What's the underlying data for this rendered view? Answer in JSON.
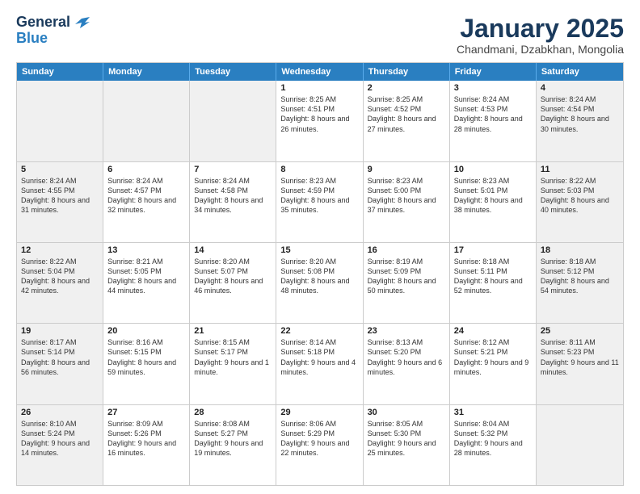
{
  "logo": {
    "general": "General",
    "blue": "Blue"
  },
  "header": {
    "title": "January 2025",
    "subtitle": "Chandmani, Dzabkhan, Mongolia"
  },
  "weekdays": [
    "Sunday",
    "Monday",
    "Tuesday",
    "Wednesday",
    "Thursday",
    "Friday",
    "Saturday"
  ],
  "weeks": [
    [
      {
        "day": "",
        "info": "",
        "shaded": true
      },
      {
        "day": "",
        "info": "",
        "shaded": true
      },
      {
        "day": "",
        "info": "",
        "shaded": true
      },
      {
        "day": "1",
        "info": "Sunrise: 8:25 AM\nSunset: 4:51 PM\nDaylight: 8 hours and 26 minutes.",
        "shaded": false
      },
      {
        "day": "2",
        "info": "Sunrise: 8:25 AM\nSunset: 4:52 PM\nDaylight: 8 hours and 27 minutes.",
        "shaded": false
      },
      {
        "day": "3",
        "info": "Sunrise: 8:24 AM\nSunset: 4:53 PM\nDaylight: 8 hours and 28 minutes.",
        "shaded": false
      },
      {
        "day": "4",
        "info": "Sunrise: 8:24 AM\nSunset: 4:54 PM\nDaylight: 8 hours and 30 minutes.",
        "shaded": true
      }
    ],
    [
      {
        "day": "5",
        "info": "Sunrise: 8:24 AM\nSunset: 4:55 PM\nDaylight: 8 hours and 31 minutes.",
        "shaded": true
      },
      {
        "day": "6",
        "info": "Sunrise: 8:24 AM\nSunset: 4:57 PM\nDaylight: 8 hours and 32 minutes.",
        "shaded": false
      },
      {
        "day": "7",
        "info": "Sunrise: 8:24 AM\nSunset: 4:58 PM\nDaylight: 8 hours and 34 minutes.",
        "shaded": false
      },
      {
        "day": "8",
        "info": "Sunrise: 8:23 AM\nSunset: 4:59 PM\nDaylight: 8 hours and 35 minutes.",
        "shaded": false
      },
      {
        "day": "9",
        "info": "Sunrise: 8:23 AM\nSunset: 5:00 PM\nDaylight: 8 hours and 37 minutes.",
        "shaded": false
      },
      {
        "day": "10",
        "info": "Sunrise: 8:23 AM\nSunset: 5:01 PM\nDaylight: 8 hours and 38 minutes.",
        "shaded": false
      },
      {
        "day": "11",
        "info": "Sunrise: 8:22 AM\nSunset: 5:03 PM\nDaylight: 8 hours and 40 minutes.",
        "shaded": true
      }
    ],
    [
      {
        "day": "12",
        "info": "Sunrise: 8:22 AM\nSunset: 5:04 PM\nDaylight: 8 hours and 42 minutes.",
        "shaded": true
      },
      {
        "day": "13",
        "info": "Sunrise: 8:21 AM\nSunset: 5:05 PM\nDaylight: 8 hours and 44 minutes.",
        "shaded": false
      },
      {
        "day": "14",
        "info": "Sunrise: 8:20 AM\nSunset: 5:07 PM\nDaylight: 8 hours and 46 minutes.",
        "shaded": false
      },
      {
        "day": "15",
        "info": "Sunrise: 8:20 AM\nSunset: 5:08 PM\nDaylight: 8 hours and 48 minutes.",
        "shaded": false
      },
      {
        "day": "16",
        "info": "Sunrise: 8:19 AM\nSunset: 5:09 PM\nDaylight: 8 hours and 50 minutes.",
        "shaded": false
      },
      {
        "day": "17",
        "info": "Sunrise: 8:18 AM\nSunset: 5:11 PM\nDaylight: 8 hours and 52 minutes.",
        "shaded": false
      },
      {
        "day": "18",
        "info": "Sunrise: 8:18 AM\nSunset: 5:12 PM\nDaylight: 8 hours and 54 minutes.",
        "shaded": true
      }
    ],
    [
      {
        "day": "19",
        "info": "Sunrise: 8:17 AM\nSunset: 5:14 PM\nDaylight: 8 hours and 56 minutes.",
        "shaded": true
      },
      {
        "day": "20",
        "info": "Sunrise: 8:16 AM\nSunset: 5:15 PM\nDaylight: 8 hours and 59 minutes.",
        "shaded": false
      },
      {
        "day": "21",
        "info": "Sunrise: 8:15 AM\nSunset: 5:17 PM\nDaylight: 9 hours and 1 minute.",
        "shaded": false
      },
      {
        "day": "22",
        "info": "Sunrise: 8:14 AM\nSunset: 5:18 PM\nDaylight: 9 hours and 4 minutes.",
        "shaded": false
      },
      {
        "day": "23",
        "info": "Sunrise: 8:13 AM\nSunset: 5:20 PM\nDaylight: 9 hours and 6 minutes.",
        "shaded": false
      },
      {
        "day": "24",
        "info": "Sunrise: 8:12 AM\nSunset: 5:21 PM\nDaylight: 9 hours and 9 minutes.",
        "shaded": false
      },
      {
        "day": "25",
        "info": "Sunrise: 8:11 AM\nSunset: 5:23 PM\nDaylight: 9 hours and 11 minutes.",
        "shaded": true
      }
    ],
    [
      {
        "day": "26",
        "info": "Sunrise: 8:10 AM\nSunset: 5:24 PM\nDaylight: 9 hours and 14 minutes.",
        "shaded": true
      },
      {
        "day": "27",
        "info": "Sunrise: 8:09 AM\nSunset: 5:26 PM\nDaylight: 9 hours and 16 minutes.",
        "shaded": false
      },
      {
        "day": "28",
        "info": "Sunrise: 8:08 AM\nSunset: 5:27 PM\nDaylight: 9 hours and 19 minutes.",
        "shaded": false
      },
      {
        "day": "29",
        "info": "Sunrise: 8:06 AM\nSunset: 5:29 PM\nDaylight: 9 hours and 22 minutes.",
        "shaded": false
      },
      {
        "day": "30",
        "info": "Sunrise: 8:05 AM\nSunset: 5:30 PM\nDaylight: 9 hours and 25 minutes.",
        "shaded": false
      },
      {
        "day": "31",
        "info": "Sunrise: 8:04 AM\nSunset: 5:32 PM\nDaylight: 9 hours and 28 minutes.",
        "shaded": false
      },
      {
        "day": "",
        "info": "",
        "shaded": true
      }
    ]
  ]
}
